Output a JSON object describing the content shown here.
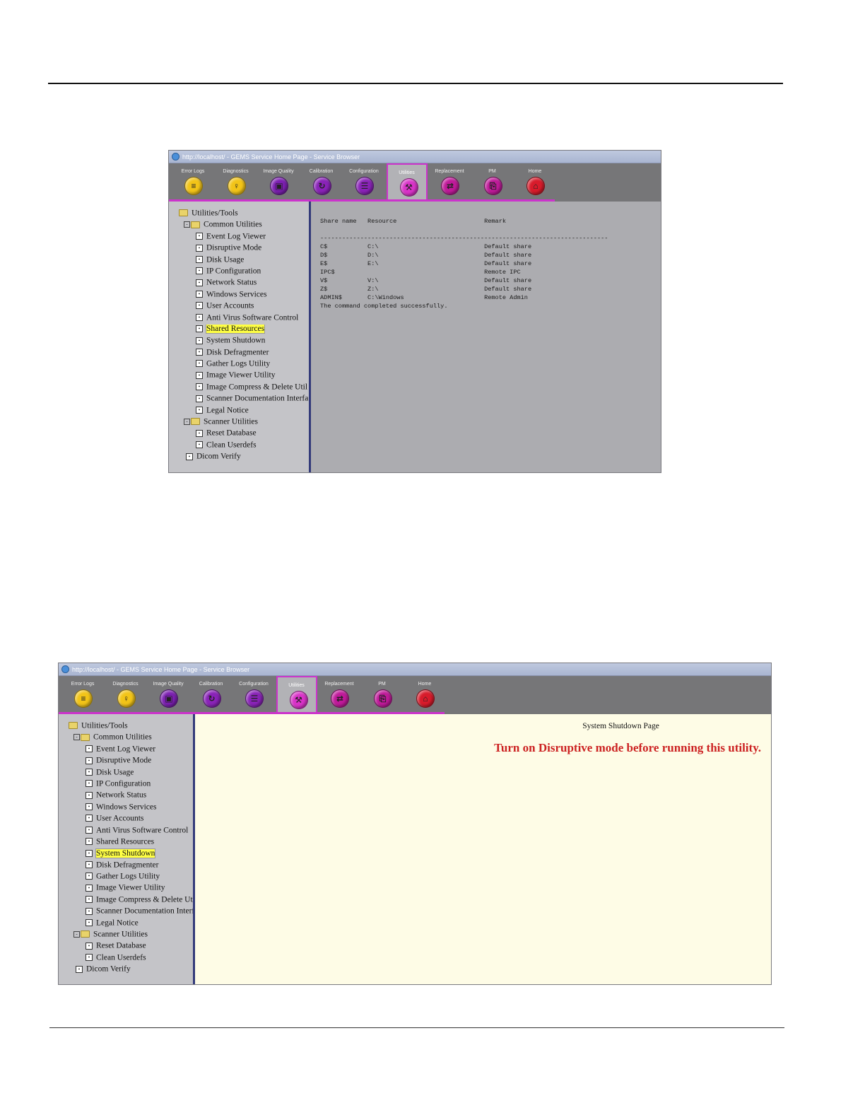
{
  "window_title": "http://localhost/ - GEMS Service Home Page - Service Browser",
  "tabs": [
    {
      "label": "Error Logs",
      "icon": "error-log-icon",
      "color": "#f2c418"
    },
    {
      "label": "Diagnostics",
      "icon": "stethoscope-icon",
      "color": "#f2c418"
    },
    {
      "label": "Image Quality",
      "icon": "monitor-icon",
      "color": "#7b1fb0"
    },
    {
      "label": "Calibration",
      "icon": "calibration-icon",
      "color": "#8a23b8"
    },
    {
      "label": "Configuration",
      "icon": "configuration-icon",
      "color": "#8a23b8"
    },
    {
      "label": "Utilities",
      "icon": "toolbox-icon",
      "color": "#d933c8"
    },
    {
      "label": "Replacement",
      "icon": "replacement-icon",
      "color": "#c01a9a"
    },
    {
      "label": "PM",
      "icon": "clipboard-icon",
      "color": "#c01a9a"
    },
    {
      "label": "Home",
      "icon": "home-icon",
      "color": "#d81b2b"
    }
  ],
  "active_tab": "Utilities",
  "tree": {
    "root": "Utilities/Tools",
    "common_group": "Common Utilities",
    "common_items": [
      "Event Log Viewer",
      "Disruptive Mode",
      "Disk Usage",
      "IP Configuration",
      "Network Status",
      "Windows Services",
      "User Accounts",
      "Anti Virus Software Control",
      "Shared Resources",
      "System Shutdown",
      "Disk Defragmenter",
      "Gather Logs Utility",
      "Image Viewer Utility",
      "Image Compress & Delete Util",
      "Scanner Documentation Interfa",
      "Legal Notice"
    ],
    "scanner_group": "Scanner Utilities",
    "scanner_items": [
      "Reset Database",
      "Clean Userdefs"
    ],
    "dicom": "Dicom Verify"
  },
  "screen1": {
    "selected_item": "Shared Resources",
    "output_lines": [
      "Share name   Resource                        Remark",
      "",
      "-------------------------------------------------------------------------------",
      "C$           C:\\                             Default share",
      "D$           D:\\                             Default share",
      "E$           E:\\                             Default share",
      "IPC$                                         Remote IPC",
      "V$           V:\\                             Default share",
      "Z$           Z:\\                             Default share",
      "ADMIN$       C:\\Windows                      Remote Admin",
      "The command completed successfully."
    ]
  },
  "screen2": {
    "selected_item": "System Shutdown",
    "page_title": "System Shutdown Page",
    "warning": "Turn on Disruptive mode before running this utility."
  }
}
